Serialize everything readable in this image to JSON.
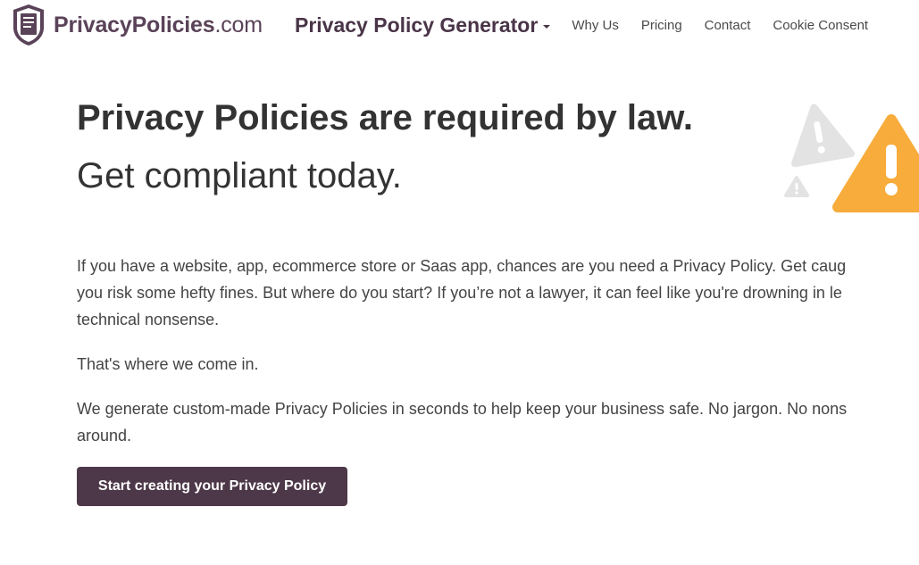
{
  "header": {
    "logo": {
      "brand": "PrivacyPolicies",
      "tld": ".com",
      "icon": "shield-document-icon"
    },
    "nav": {
      "main_label": "Privacy Policy Generator",
      "links": [
        "Why Us",
        "Pricing",
        "Contact",
        "Cookie Consent"
      ]
    }
  },
  "hero": {
    "headline": "Privacy Policies are required by law.",
    "subheadline": "Get compliant today.",
    "illustration": "warning-triangles-icon",
    "paragraphs": [
      [
        "If you have a website, app, ecommerce store or Saas app, chances are you need a Privacy Policy. Get caug",
        "you risk some hefty fines. But where do you start? If you’re not a lawyer, it can feel like you're drowning in le",
        "technical nonsense."
      ],
      [
        "That's where we come in."
      ],
      [
        "We generate custom-made Privacy Policies in seconds to help keep your business safe. No jargon. No nons",
        "around."
      ]
    ],
    "cta_label": "Start creating your Privacy Policy"
  },
  "colors": {
    "brand_purple": "#4d3849",
    "logo_text": "#5a4358",
    "warning_orange": "#f7ac3b",
    "warning_gray": "#e3e3e3"
  }
}
